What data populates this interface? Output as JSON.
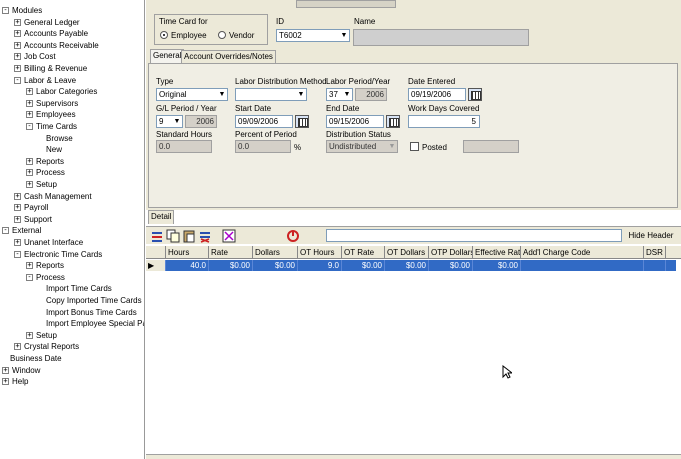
{
  "tree": [
    {
      "label": "Modules",
      "indent": 0,
      "box": "-"
    },
    {
      "label": "General Ledger",
      "indent": 1,
      "box": "+"
    },
    {
      "label": "Accounts Payable",
      "indent": 1,
      "box": "+"
    },
    {
      "label": "Accounts Receivable",
      "indent": 1,
      "box": "+"
    },
    {
      "label": "Job Cost",
      "indent": 1,
      "box": "+"
    },
    {
      "label": "Billing & Revenue",
      "indent": 1,
      "box": "+"
    },
    {
      "label": "Labor & Leave",
      "indent": 1,
      "box": "-"
    },
    {
      "label": "Labor Categories",
      "indent": 2,
      "box": "+"
    },
    {
      "label": "Supervisors",
      "indent": 2,
      "box": "+"
    },
    {
      "label": "Employees",
      "indent": 2,
      "box": "+"
    },
    {
      "label": "Time Cards",
      "indent": 2,
      "box": "-"
    },
    {
      "label": "Browse",
      "indent": 3,
      "box": ""
    },
    {
      "label": "New",
      "indent": 3,
      "box": ""
    },
    {
      "label": "Reports",
      "indent": 2,
      "box": "+"
    },
    {
      "label": "Process",
      "indent": 2,
      "box": "+"
    },
    {
      "label": "Setup",
      "indent": 2,
      "box": "+"
    },
    {
      "label": "Cash Management",
      "indent": 1,
      "box": "+"
    },
    {
      "label": "Payroll",
      "indent": 1,
      "box": "+"
    },
    {
      "label": "Support",
      "indent": 1,
      "box": "+"
    },
    {
      "label": "External",
      "indent": 0,
      "box": "-"
    },
    {
      "label": "Unanet Interface",
      "indent": 1,
      "box": "+"
    },
    {
      "label": "Electronic Time Cards",
      "indent": 1,
      "box": "-"
    },
    {
      "label": "Reports",
      "indent": 2,
      "box": "+"
    },
    {
      "label": "Process",
      "indent": 2,
      "box": "-"
    },
    {
      "label": "Import Time Cards",
      "indent": 3,
      "box": ""
    },
    {
      "label": "Copy Imported Time Cards",
      "indent": 3,
      "box": ""
    },
    {
      "label": "Import Bonus Time Cards",
      "indent": 3,
      "box": ""
    },
    {
      "label": "Import Employee Special Pay",
      "indent": 3,
      "box": ""
    },
    {
      "label": "Setup",
      "indent": 2,
      "box": "+"
    },
    {
      "label": "Crystal Reports",
      "indent": 1,
      "box": "+"
    },
    {
      "label": "Business Date",
      "indent": 0,
      "box": ""
    },
    {
      "label": "Window",
      "indent": 0,
      "box": "+"
    },
    {
      "label": "Help",
      "indent": 0,
      "box": "+"
    }
  ],
  "header": {
    "timecard_for_label": "Time Card for",
    "employee_label": "Employee",
    "vendor_label": "Vendor",
    "id_label": "ID",
    "id_value": "T6002",
    "name_label": "Name",
    "name_value": ""
  },
  "tabs": [
    "General",
    "Account Overrides/Notes"
  ],
  "general": {
    "type_label": "Type",
    "type_value": "Original",
    "ldm_label": "Labor Distribution Method",
    "ldm_value": "",
    "lpy_label": "Labor Period/Year",
    "lpy_period": "37",
    "lpy_year": "2006",
    "date_entered_label": "Date Entered",
    "date_entered_value": "09/19/2006",
    "glpy_label": "G/L Period / Year",
    "glpy_period": "9",
    "glpy_year": "2006",
    "start_date_label": "Start Date",
    "start_date_value": "09/09/2006",
    "end_date_label": "End Date",
    "end_date_value": "09/15/2006",
    "work_days_label": "Work Days Covered",
    "work_days_value": "5",
    "std_hours_label": "Standard Hours",
    "std_hours_value": "0.0",
    "pct_period_label": "Percent of Period",
    "pct_period_value": "0.0",
    "pct_sign": "%",
    "dist_status_label": "Distribution Status",
    "dist_status_value": "Undistributed",
    "posted_label": "Posted",
    "posted_value": ""
  },
  "detail": {
    "tab_label": "Detail",
    "hide_header_label": "Hide Header",
    "columns": [
      "Hours",
      "Rate",
      "Dollars",
      "OT Hours",
      "OT Rate",
      "OT Dollars",
      "OTP Dollars",
      "Effective Rate",
      "Add'l Charge Code",
      "DSR"
    ],
    "row": [
      "40.0",
      "$0.00",
      "$0.00",
      "9.0",
      "$0.00",
      "$0.00",
      "$0.00",
      "$0.00",
      "",
      ""
    ]
  },
  "colors": {
    "form_bg": "#ece9d8",
    "selection": "#316ac5"
  }
}
